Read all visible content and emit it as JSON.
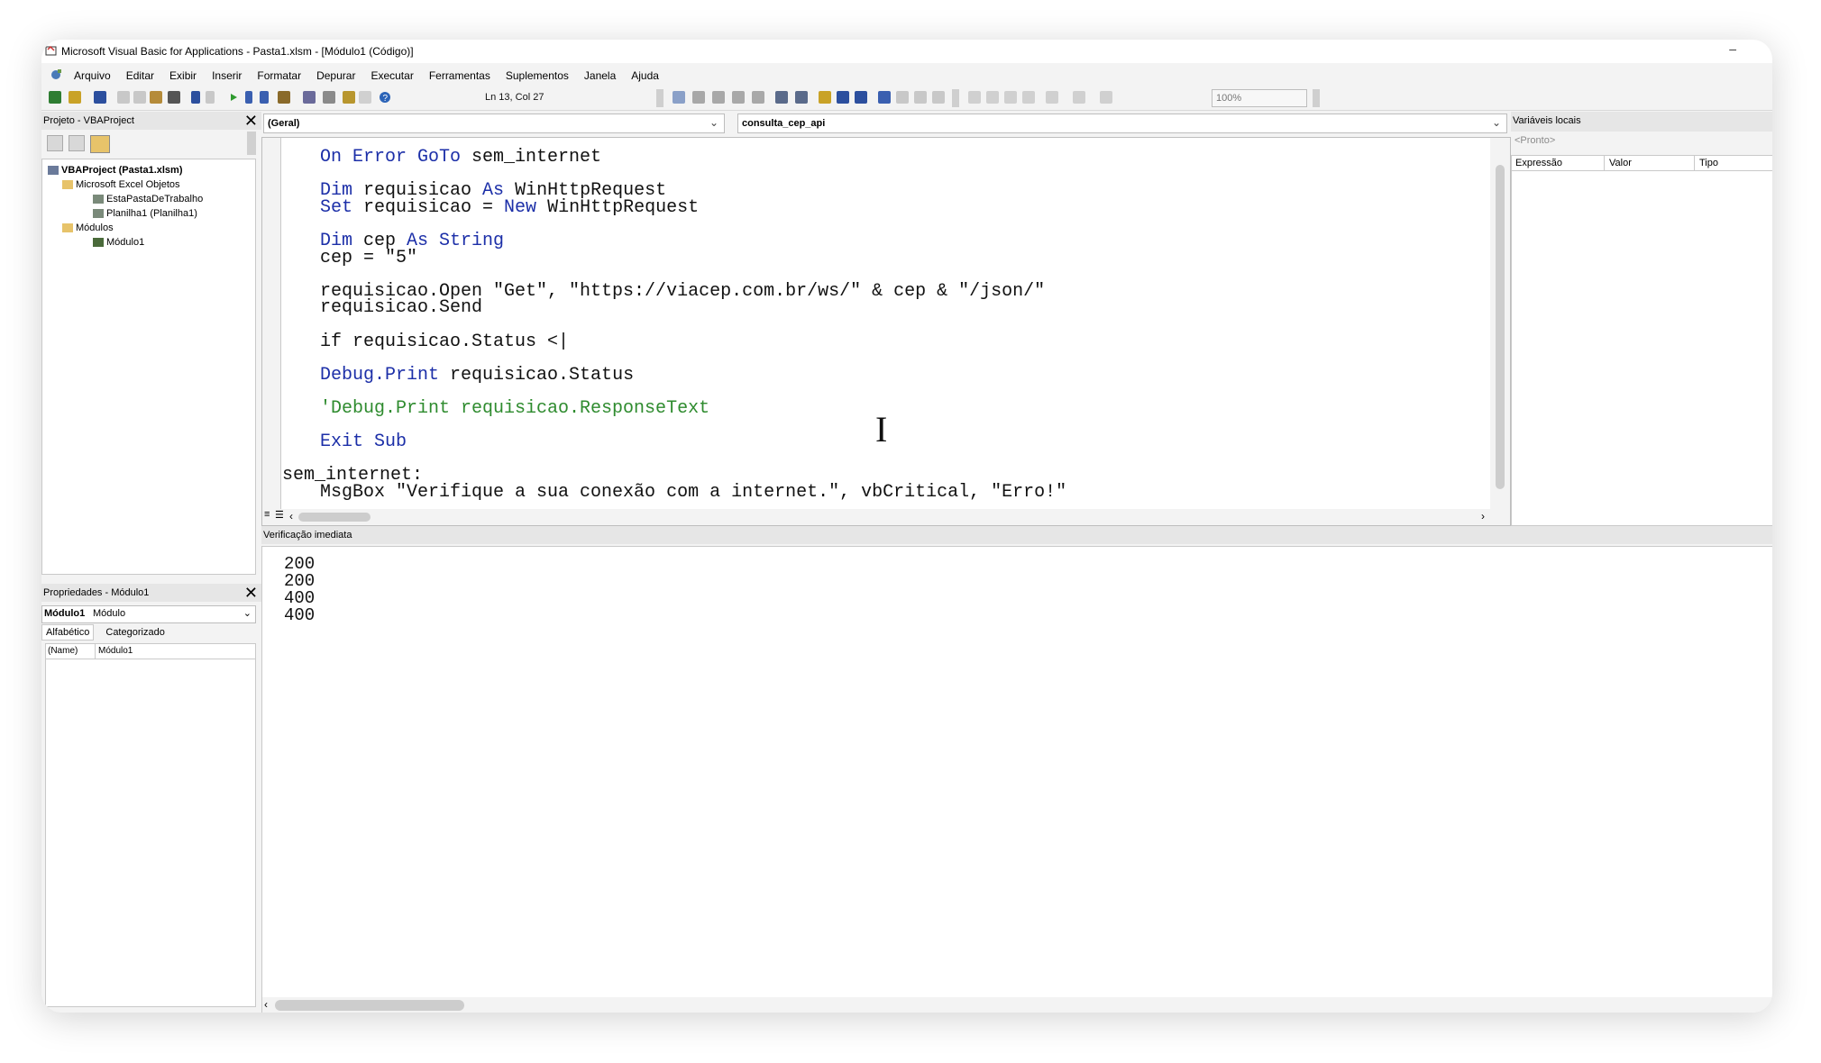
{
  "window": {
    "title": "Microsoft Visual Basic for Applications - Pasta1.xlsm - [Módulo1 (Código)]",
    "minimize": "–"
  },
  "menu": [
    "Arquivo",
    "Editar",
    "Exibir",
    "Inserir",
    "Formatar",
    "Depurar",
    "Executar",
    "Ferramentas",
    "Suplementos",
    "Janela",
    "Ajuda"
  ],
  "toolbar": {
    "position": "Ln 13, Col 27",
    "zoom": "100%"
  },
  "project": {
    "title": "Projeto - VBAProject",
    "close": "✕",
    "tree": [
      {
        "label": "VBAProject (Pasta1.xlsm)",
        "bold": true
      },
      {
        "label": "Microsoft Excel Objetos"
      },
      {
        "label": "EstaPastaDeTrabalho"
      },
      {
        "label": "Planilha1 (Planilha1)"
      },
      {
        "label": "Módulos"
      },
      {
        "label": "Módulo1"
      }
    ]
  },
  "properties": {
    "title": "Propriedades - Módulo1",
    "close": "✕",
    "object_name": "Módulo1",
    "object_type": "Módulo",
    "tabs": [
      "Alfabético",
      "Categorizado"
    ],
    "row_key": "(Name)",
    "row_value": "Módulo1"
  },
  "editor": {
    "object_combo": "(Geral)",
    "procedure_combo": "consulta_cep_api",
    "lines": [
      {
        "indent": 1,
        "parts": [
          {
            "t": "On Error GoTo",
            "k": "kw"
          },
          {
            "t": " sem_internet"
          }
        ]
      },
      {
        "indent": 1,
        "parts": [
          {
            "t": "Dim",
            "k": "kw"
          },
          {
            "t": " requisicao "
          },
          {
            "t": "As",
            "k": "kw"
          },
          {
            "t": " WinHttpRequest"
          }
        ]
      },
      {
        "indent": 1,
        "parts": [
          {
            "t": "Set",
            "k": "kw"
          },
          {
            "t": " requisicao = "
          },
          {
            "t": "New",
            "k": "kw"
          },
          {
            "t": " WinHttpRequest"
          }
        ]
      },
      {
        "indent": 1,
        "parts": [
          {
            "t": "Dim",
            "k": "kw"
          },
          {
            "t": " cep "
          },
          {
            "t": "As String",
            "k": "kw"
          }
        ]
      },
      {
        "indent": 1,
        "parts": [
          {
            "t": "cep = \"5\""
          }
        ]
      },
      {
        "indent": 1,
        "parts": [
          {
            "t": "requisicao.Open \"Get\", \"https://viacep.com.br/ws/\" & cep & \"/json/\""
          }
        ]
      },
      {
        "indent": 1,
        "parts": [
          {
            "t": "requisicao.Send"
          }
        ]
      },
      {
        "indent": 1,
        "parts": [
          {
            "t": "if requisicao.Status <|"
          }
        ]
      },
      {
        "indent": 1,
        "parts": [
          {
            "t": "Debug.Print",
            "k": "kw"
          },
          {
            "t": " requisicao.Status"
          }
        ]
      },
      {
        "indent": 1,
        "parts": [
          {
            "t": "'Debug.Print requisicao.ResponseText",
            "k": "cm"
          }
        ]
      },
      {
        "indent": 1,
        "parts": [
          {
            "t": "Exit Sub",
            "k": "kw"
          }
        ]
      },
      {
        "indent": 0,
        "parts": [
          {
            "t": "sem_internet:"
          }
        ]
      },
      {
        "indent": 1,
        "parts": [
          {
            "t": "MsgBox \"Verifique a sua conexão com a internet.\", vbCritical, \"Erro!\""
          }
        ]
      }
    ]
  },
  "locals": {
    "title": "Variáveis locais",
    "status": "<Pronto>",
    "columns": [
      "Expressão",
      "Valor",
      "Tipo"
    ]
  },
  "immediate": {
    "title": "Verificação imediata",
    "lines": [
      "200",
      "200",
      "400",
      "400"
    ]
  },
  "colors": {
    "keyword": "#1c2fa8",
    "comment": "#2e8b2e",
    "panel": "#f3f3f3"
  }
}
